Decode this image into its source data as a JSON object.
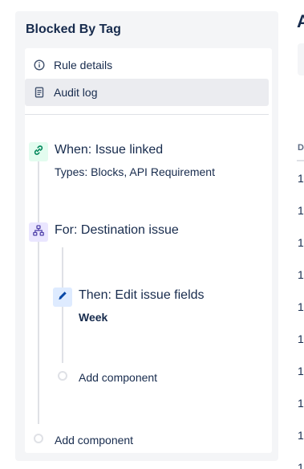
{
  "panel": {
    "title": "Blocked By Tag"
  },
  "menu": {
    "rule_details": {
      "label": "Rule details",
      "icon": "info-icon"
    },
    "audit_log": {
      "label": "Audit log",
      "icon": "document-icon"
    }
  },
  "rule": {
    "trigger": {
      "title": "When: Issue linked",
      "subtitle": "Types: Blocks, API Requirement",
      "icon": "link-icon",
      "color": "#e3fcef"
    },
    "branch": {
      "title": "For: Destination issue",
      "icon": "hierarchy-icon",
      "color": "#eae6ff"
    },
    "action": {
      "title": "Then: Edit issue fields",
      "subtitle": "Week",
      "icon": "pencil-icon",
      "color": "#deebff"
    },
    "add_nested": "Add component",
    "add_root": "Add component"
  },
  "right": {
    "heading": "A",
    "column_header": "D",
    "rows": [
      "1",
      "1",
      "1",
      "1",
      "1",
      "1",
      "1",
      "1",
      "1",
      "1"
    ]
  }
}
